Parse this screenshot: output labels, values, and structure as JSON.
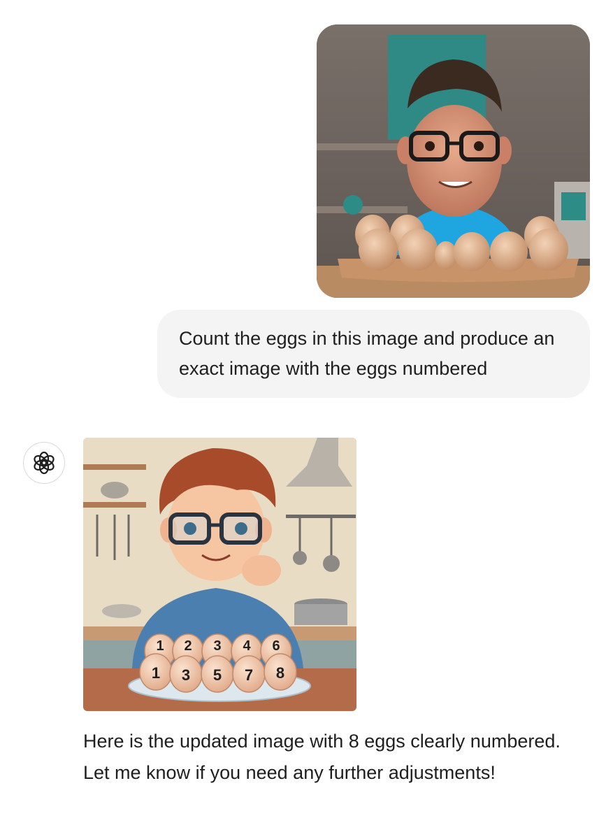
{
  "conversation": {
    "user_message": {
      "image_alt": "3D cartoon man with glasses behind a tray of eggs in a kitchen",
      "text": "Count the eggs in this image and produce an exact image with the eggs numbered"
    },
    "assistant_message": {
      "avatar_icon": "openai-logo-icon",
      "image_alt": "Cartoon illustration of a man with glasses and numbered eggs on a plate",
      "egg_numbers_back": [
        "1",
        "2",
        "3",
        "4",
        "6"
      ],
      "egg_numbers_front": [
        "1",
        "3",
        "5",
        "7",
        "8"
      ],
      "text": "Here is the updated image with 8 eggs clearly numbered. Let me know if you need any further adjustments!"
    }
  },
  "colors": {
    "user_bubble_bg": "#f4f4f4",
    "text": "#1f1f1f",
    "avatar_border": "#d9d9d9"
  }
}
